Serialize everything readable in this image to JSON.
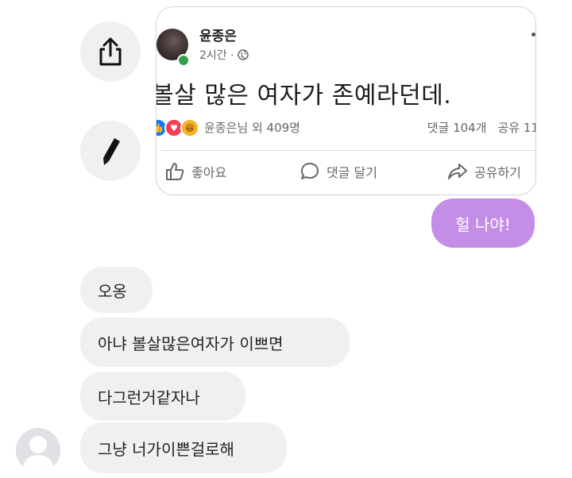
{
  "post": {
    "author": "윤종은",
    "time": "2시간 ·",
    "text": "볼살 많은 여자가 존예라던데.",
    "reactions_text": "윤종은님 외 409명",
    "comments": "댓글 104개",
    "shares": "공유 11",
    "actions": {
      "like": "좋아요",
      "comment": "댓글 달기",
      "share": "공유하기"
    }
  },
  "messages": {
    "sent": [
      "헐 나야!"
    ],
    "received": [
      "오옹",
      "아냐 볼살많은여자가 이쁘면",
      "다그런거같자나",
      "그냥 너가이쁜걸로해"
    ]
  },
  "icons": {
    "share_side": "share-upload-icon",
    "edit_side": "pencil-icon",
    "globe": "globe-icon",
    "like": "thumbs-up-icon",
    "comment": "comment-bubble-icon",
    "share": "share-arrow-icon"
  },
  "colors": {
    "sent_bubble": "#c48ee6",
    "received_bubble": "#f0f0f1",
    "online": "#31a24c"
  }
}
